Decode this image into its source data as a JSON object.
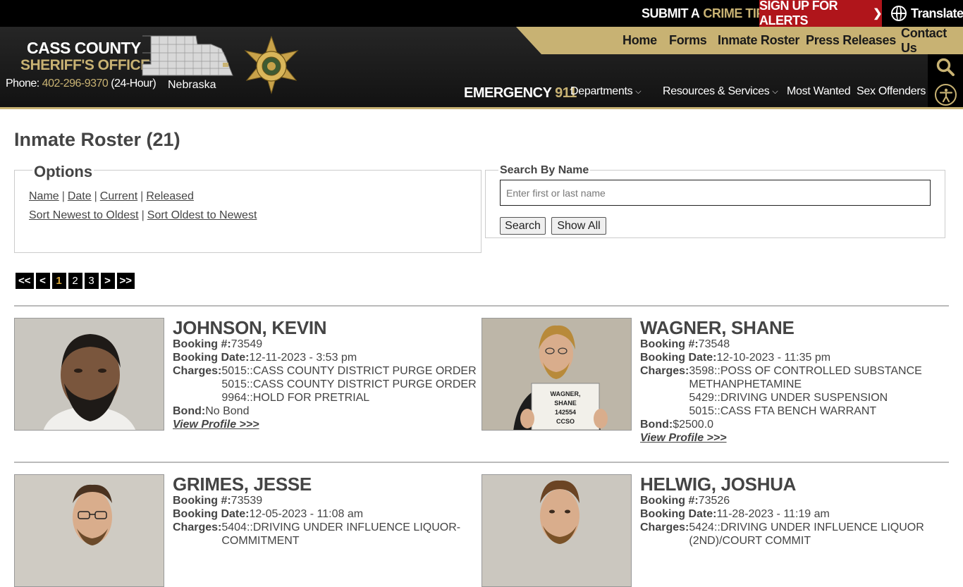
{
  "topbar": {
    "tip_prefix": "SUBMIT A",
    "tip_gold": "CRIME TIP",
    "alerts": "SIGN UP FOR ALERTS",
    "translate": "Translate"
  },
  "brand": {
    "line1": "CASS COUNTY",
    "line2": "SHERIFF'S OFFICE",
    "phone_label": "Phone:",
    "phone_number": "402-296-9370",
    "phone_suffix": "(24-Hour)",
    "state": "Nebraska"
  },
  "nav_primary": [
    "Home",
    "Forms",
    "Inmate Roster",
    "Press Releases",
    "Contact Us"
  ],
  "emergency": {
    "label": "EMERGENCY",
    "number": "911"
  },
  "nav_secondary": {
    "departments": "Departments",
    "resources": "Resources & Services",
    "wanted": "Most Wanted",
    "offenders": "Sex Offenders"
  },
  "page": {
    "title": "Inmate Roster (21)"
  },
  "options": {
    "legend": "Options",
    "filters": [
      "Name",
      "Date",
      "Current",
      "Released"
    ],
    "sorts": [
      "Sort Newest to Oldest",
      "Sort Oldest to Newest"
    ]
  },
  "search": {
    "legend": "Search By Name",
    "placeholder": "Enter first or last name",
    "value": "",
    "search_btn": "Search",
    "show_all_btn": "Show All"
  },
  "pagination": [
    "<<",
    "<",
    "1",
    "2",
    "3",
    ">",
    ">>"
  ],
  "labels": {
    "booking_no": "Booking #:",
    "booking_date": "Booking Date:",
    "charges": "Charges:",
    "bond": "Bond:",
    "view_profile": "View Profile >>>"
  },
  "inmates": [
    {
      "name": "JOHNSON, KEVIN",
      "booking_no": "73549",
      "booking_date": "12-11-2023 - 3:53 pm",
      "charges": [
        "5015::CASS COUNTY DISTRICT PURGE ORDER",
        "5015::CASS COUNTY DISTRICT PURGE ORDER",
        "9964::HOLD FOR PRETRIAL"
      ],
      "bond": "No Bond"
    },
    {
      "name": "WAGNER, SHANE",
      "booking_no": "73548",
      "booking_date": "12-10-2023 - 11:35 pm",
      "charges": [
        "3598::POSS OF CONTROLLED SUBSTANCE",
        "METHANPHETAMINE",
        "5429::DRIVING UNDER SUSPENSION",
        "5015::CASS FTA BENCH WARRANT"
      ],
      "bond": "$2500.0",
      "sign": [
        "WAGNER,",
        "SHANE",
        "142554",
        "CCSO"
      ]
    },
    {
      "name": "GRIMES, JESSE",
      "booking_no": "73539",
      "booking_date": "12-05-2023 - 11:08 am",
      "charges": [
        "5404::DRIVING UNDER INFLUENCE LIQUOR-",
        "COMMITMENT"
      ]
    },
    {
      "name": "HELWIG, JOSHUA",
      "booking_no": "73526",
      "booking_date": "11-28-2023 - 11:19 am",
      "charges": [
        "5424::DRIVING UNDER INFLUENCE LIQUOR",
        "(2ND)/COURT COMMIT"
      ]
    }
  ]
}
